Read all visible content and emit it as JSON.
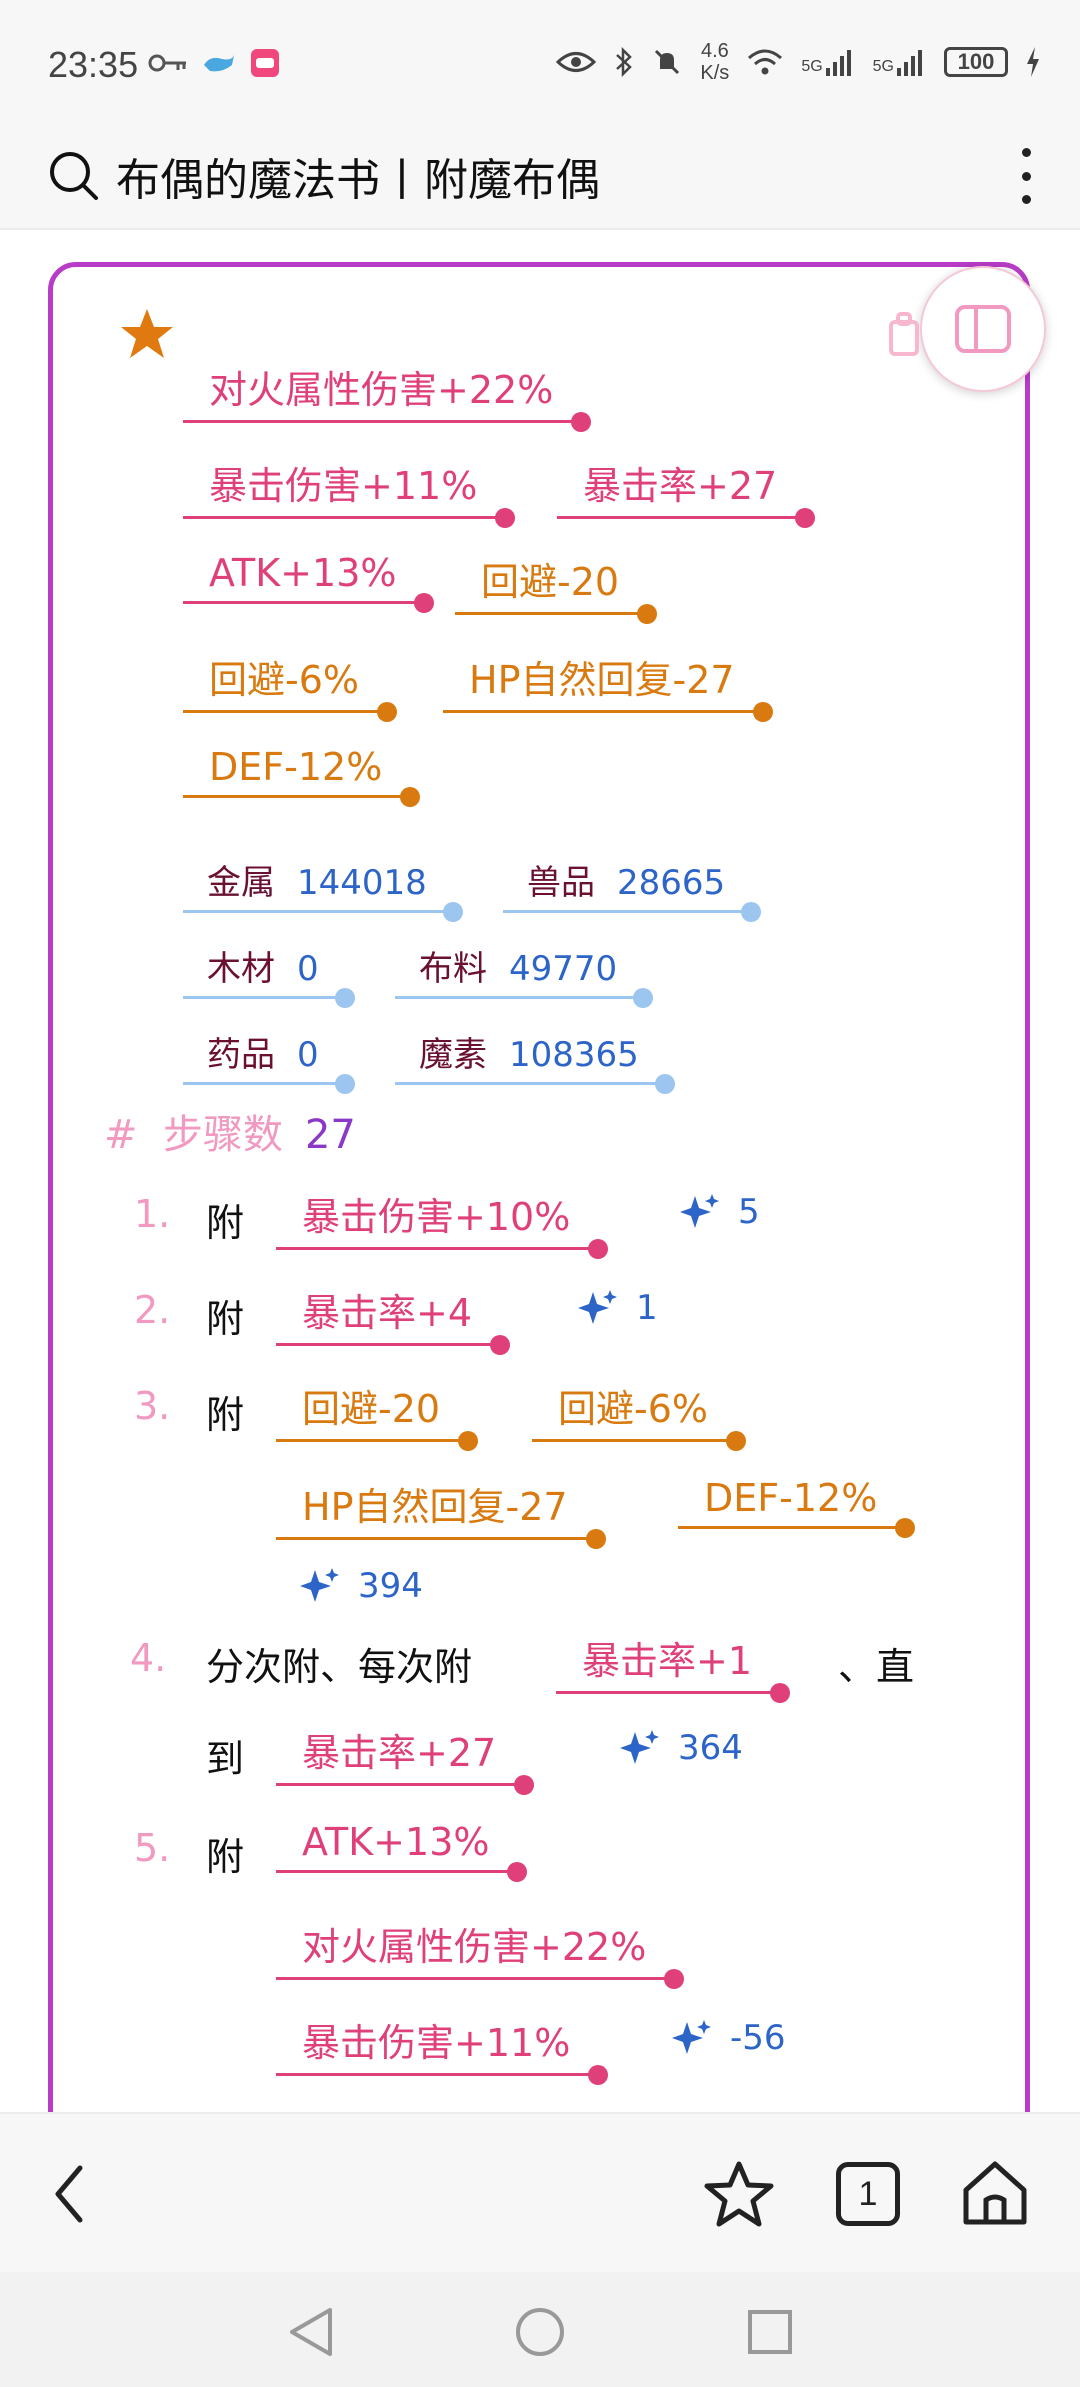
{
  "status_bar": {
    "time": "23:35",
    "net_speed_top": "4.6",
    "net_speed_bottom": "K/s",
    "sig1": "5G",
    "sig2": "5G",
    "battery": "100"
  },
  "top_bar": {
    "title": "布偶的魔法书丨附魔布偶"
  },
  "target_stats": [
    {
      "label": "对火属性伤害+22%",
      "color": "pink"
    },
    {
      "label": "暴击伤害+11%",
      "color": "pink"
    },
    {
      "label": "暴击率+27",
      "color": "pink"
    },
    {
      "label": "ATK+13%",
      "color": "pink"
    },
    {
      "label": "回避-20",
      "color": "orange"
    },
    {
      "label": "回避-6%",
      "color": "orange"
    },
    {
      "label": "HP自然回复-27",
      "color": "orange"
    },
    {
      "label": "DEF-12%",
      "color": "orange"
    }
  ],
  "materials": [
    {
      "name": "金属",
      "value": "144018"
    },
    {
      "name": "兽品",
      "value": "28665"
    },
    {
      "name": "木材",
      "value": "0"
    },
    {
      "name": "布料",
      "value": "49770"
    },
    {
      "name": "药品",
      "value": "0"
    },
    {
      "name": "魔素",
      "value": "108365"
    }
  ],
  "steps_section": {
    "hash": "#",
    "title": "步骤数",
    "count": "27"
  },
  "steps": [
    {
      "num": "1.",
      "prefix": "附",
      "chips": [
        "暴击伤害+10%"
      ],
      "sparkle": "5"
    },
    {
      "num": "2.",
      "prefix": "附",
      "chips": [
        "暴击率+4"
      ],
      "sparkle": "1"
    },
    {
      "num": "3.",
      "prefix": "附",
      "chips": [
        "回避-20",
        "回避-6%",
        "HP自然回复-27",
        "DEF-12%"
      ],
      "sparkle": "394"
    },
    {
      "num": "4.",
      "prefix": "分次附、每次附",
      "chips": [
        "暴击率+1"
      ],
      "suffix": "、直",
      "line2_prefix": "到",
      "chips2": [
        "暴击率+27"
      ],
      "sparkle": "364"
    },
    {
      "num": "5.",
      "prefix": "附",
      "chips": [
        "ATK+13%",
        "对火属性伤害+22%",
        "暴击伤害+11%"
      ],
      "sparkle": "-56"
    }
  ],
  "bottom_nav": {
    "tabs_count": "1"
  }
}
